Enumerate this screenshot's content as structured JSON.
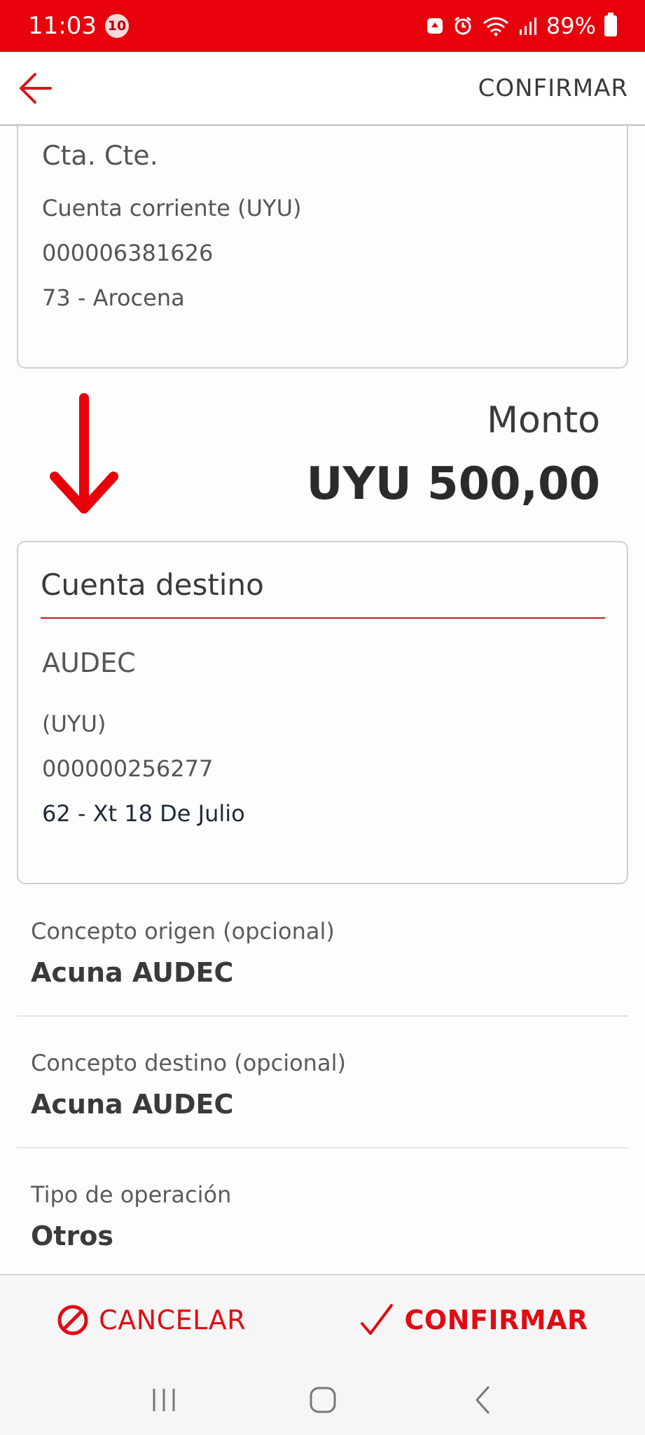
{
  "status_bar": {
    "time": "11:03",
    "notification_count": "10",
    "battery": "89%"
  },
  "app_bar": {
    "confirm_label": "CONFIRMAR"
  },
  "origin_account": {
    "name": "Cta. Cte.",
    "type": "Cuenta corriente (UYU)",
    "number": "000006381626",
    "branch": "73 - Arocena"
  },
  "amount": {
    "label": "Monto",
    "value": "UYU 500,00"
  },
  "destination_account": {
    "header": "Cuenta destino",
    "name": "AUDEC",
    "currency": "(UYU)",
    "number": "000000256277",
    "branch": "62 - Xt 18 De Julio"
  },
  "fields": [
    {
      "label": "Concepto origen (opcional)",
      "value": "Acuna AUDEC"
    },
    {
      "label": "Concepto destino (opcional)",
      "value": "Acuna AUDEC"
    },
    {
      "label": "Tipo de operación",
      "value": "Otros"
    }
  ],
  "actions": {
    "cancel_label": "CANCELAR",
    "confirm_label": "CONFIRMAR"
  },
  "colors": {
    "brand_red": "#e8000b",
    "action_red": "#e00b13"
  }
}
